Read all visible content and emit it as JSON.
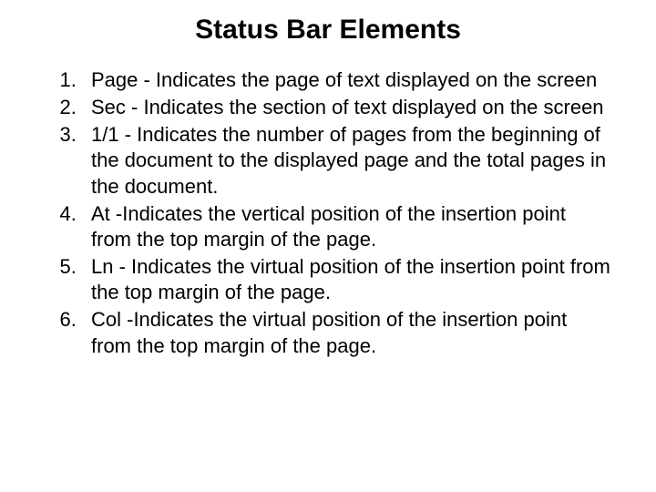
{
  "title": "Status Bar Elements",
  "items": [
    "Page - Indicates the page of text displayed on the screen",
    "Sec  - Indicates the section of text displayed on the screen",
    "1/1   - Indicates the number of pages from the beginning of the document to the displayed page and the total pages in the document.",
    "At    -Indicates the vertical position of the insertion point from the top margin of the page.",
    "Ln   - Indicates the virtual position of the insertion point from the top margin of the page.",
    "Col -Indicates the virtual position of the insertion point from the top margin of the page."
  ]
}
